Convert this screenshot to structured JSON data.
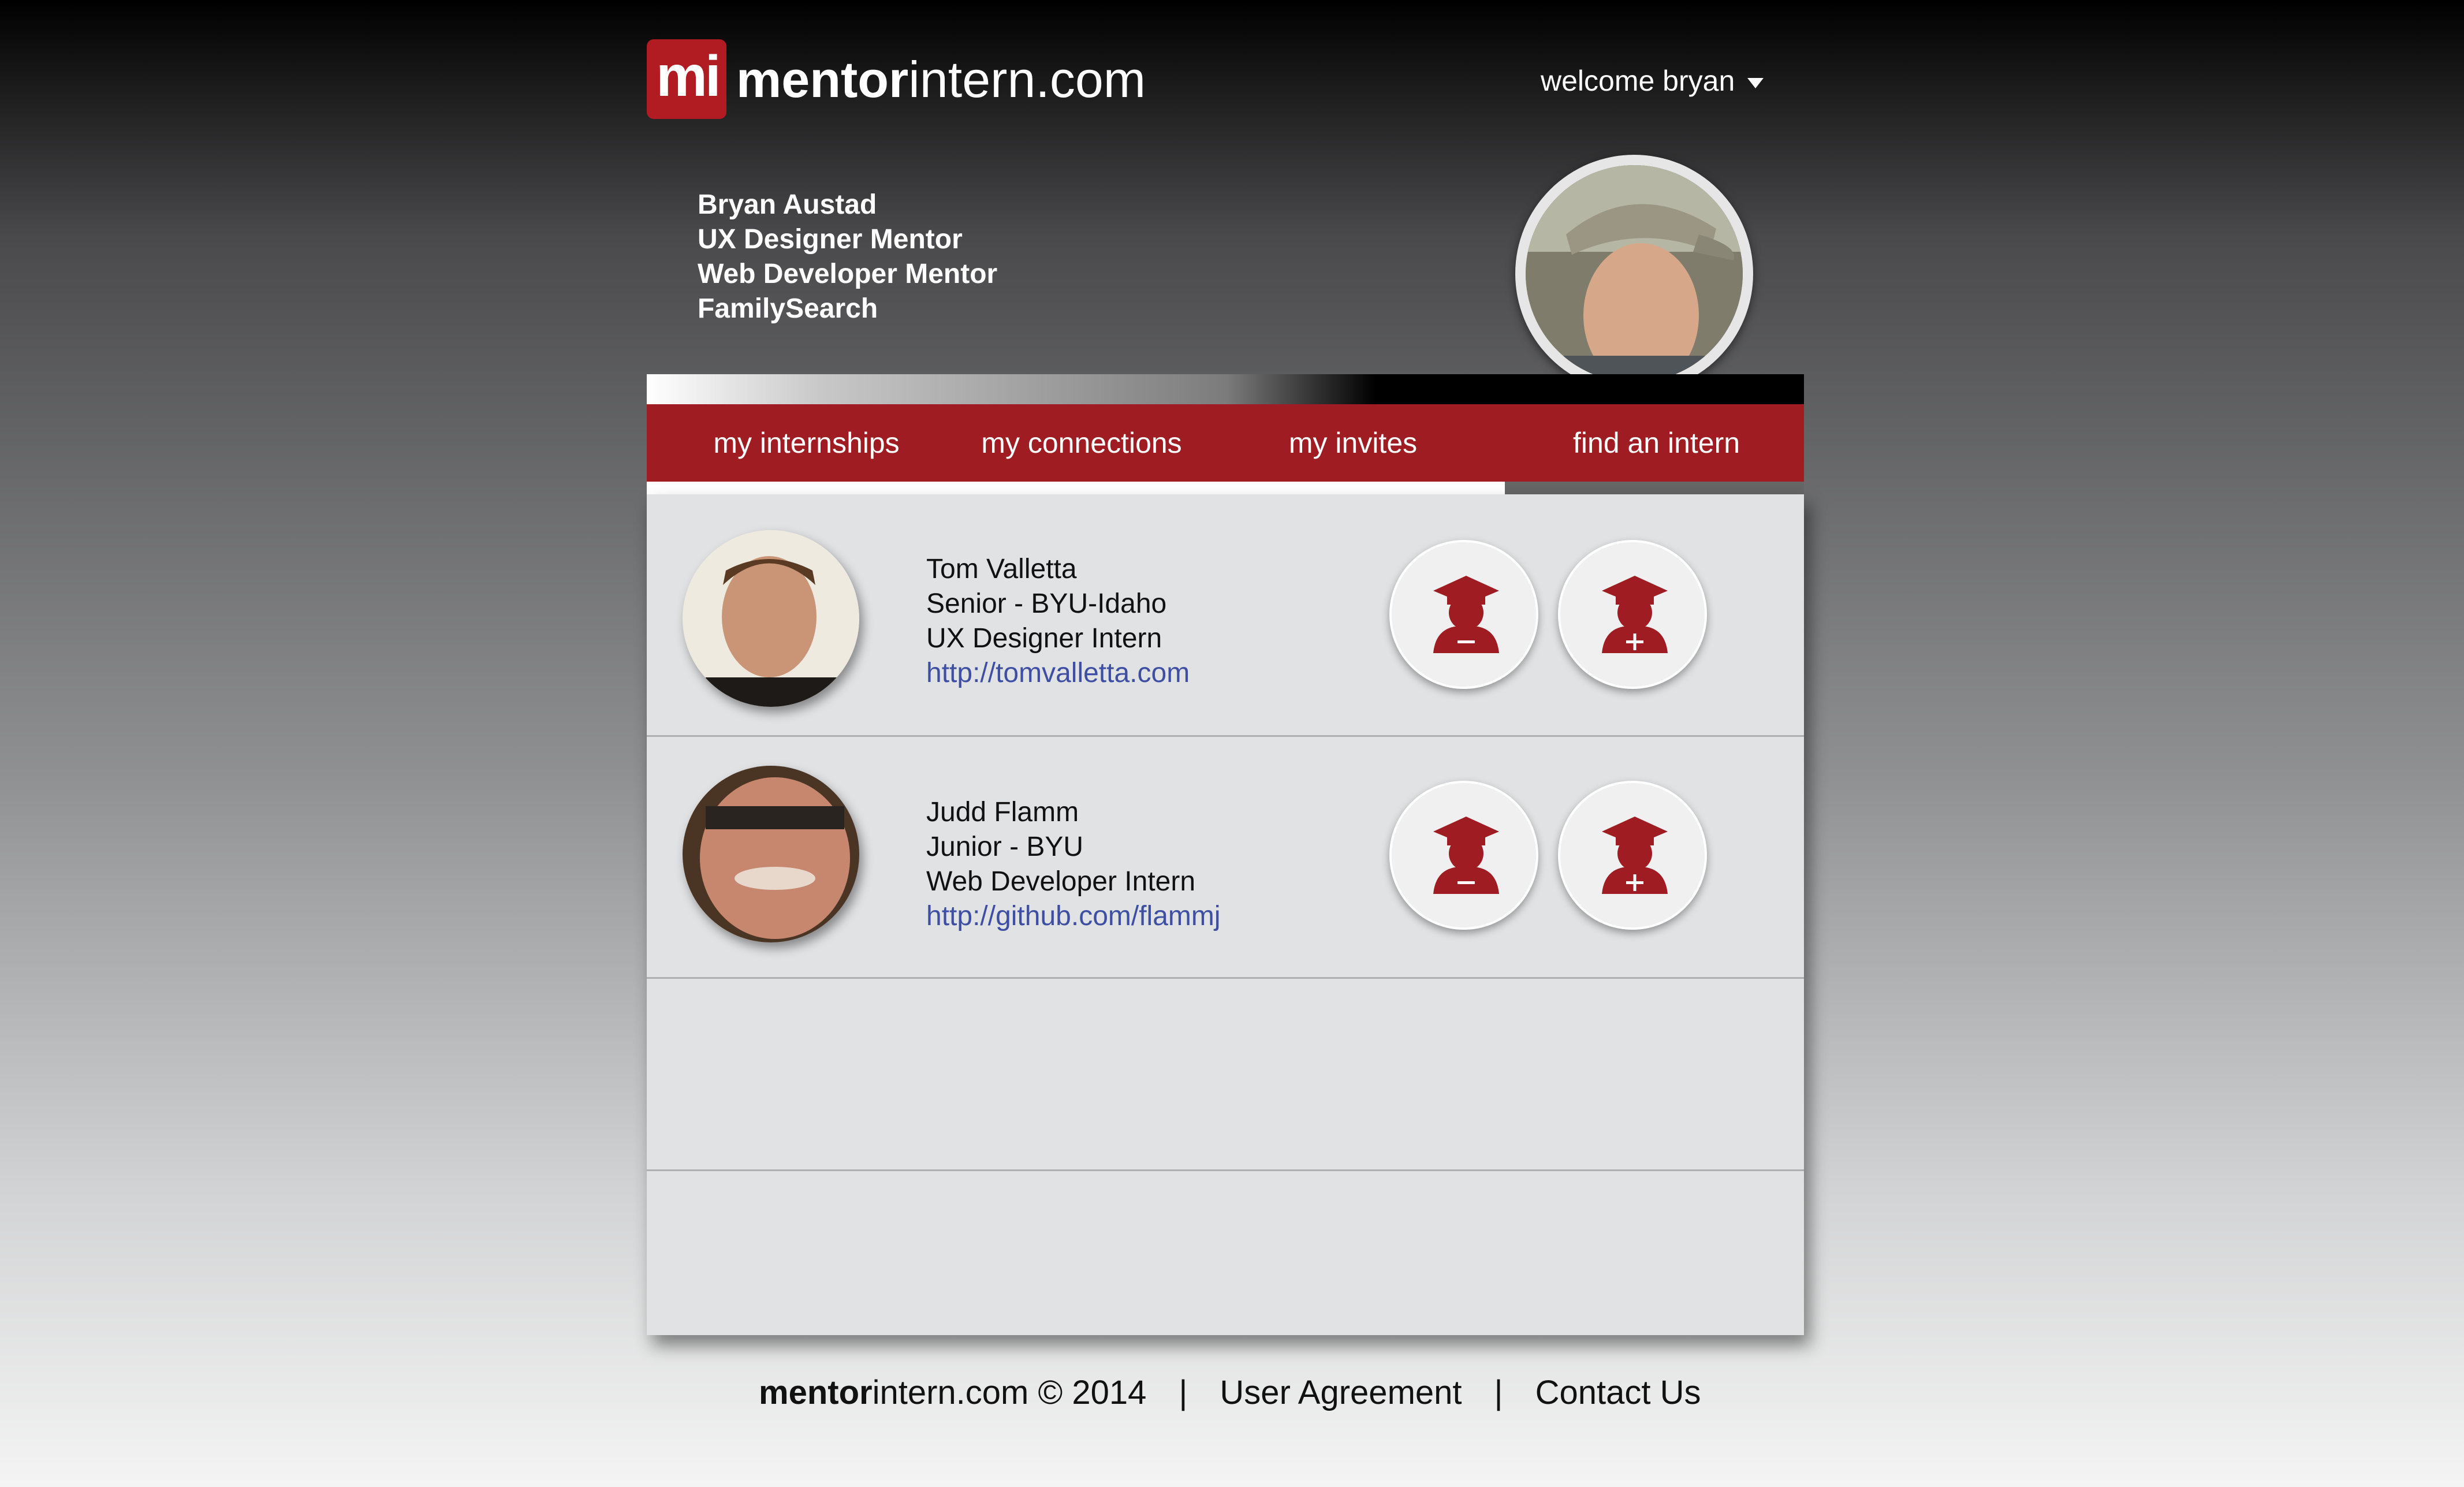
{
  "brand": {
    "badge": "mi",
    "name_bold": "mentor",
    "name_rest": "intern.com"
  },
  "header": {
    "welcome": "welcome bryan"
  },
  "profile": {
    "name": "Bryan Austad",
    "roles": [
      "UX Designer Mentor",
      "Web Developer Mentor",
      "FamilySearch"
    ]
  },
  "nav": {
    "tabs": [
      "my internships",
      "my connections",
      "my invites",
      "find an intern"
    ],
    "active": "find an intern"
  },
  "interns": [
    {
      "name": "Tom Valletta",
      "school": "Senior - BYU-Idaho",
      "role": "UX Designer Intern",
      "url": "http://tomvalletta.com"
    },
    {
      "name": "Judd Flamm",
      "school": "Junior - BYU",
      "role": "Web Developer Intern",
      "url": "http://github.com/flammj"
    }
  ],
  "actions": {
    "remove_icon": "graduate-minus-icon",
    "add_icon": "graduate-plus-icon"
  },
  "footer": {
    "brand_bold": "mentor",
    "brand_rest": "intern.com © 2014",
    "separator": "|",
    "user_agreement": "User Agreement",
    "contact": "Contact Us"
  },
  "colors": {
    "brand_red": "#9e1c22",
    "link": "#3e4fa3",
    "panel": "#e1e2e4"
  }
}
